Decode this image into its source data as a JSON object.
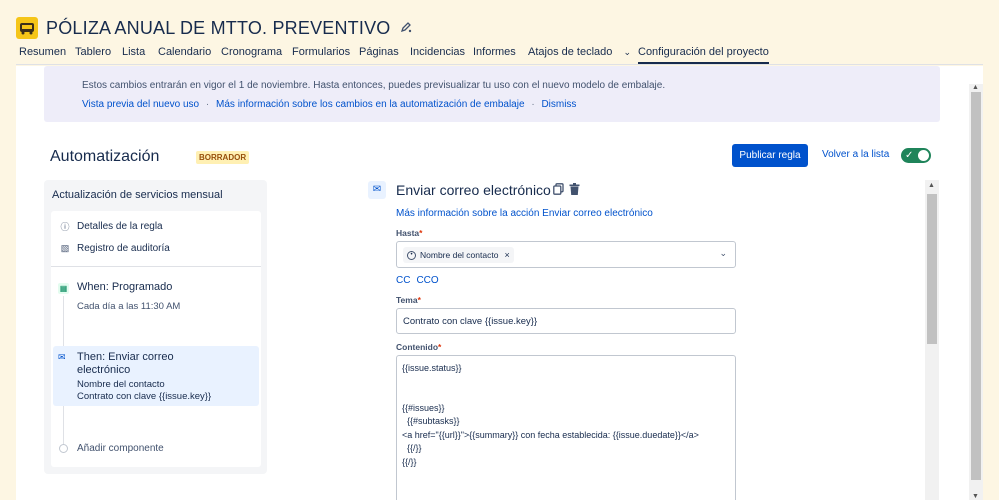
{
  "project": {
    "title": "PÓLIZA ANUAL DE MTTO. PREVENTIVO",
    "icon": "project-avatar-icon",
    "icon_color": "#f5c518"
  },
  "tabs": [
    {
      "label": "Resumen"
    },
    {
      "label": "Tablero"
    },
    {
      "label": "Lista"
    },
    {
      "label": "Calendario"
    },
    {
      "label": "Cronograma"
    },
    {
      "label": "Formularios"
    },
    {
      "label": "Páginas"
    },
    {
      "label": "Incidencias"
    },
    {
      "label": "Informes"
    },
    {
      "label": "Atajos de teclado"
    },
    {
      "label": "Configuración del proyecto"
    }
  ],
  "banner": {
    "text": "Estos cambios entrarán en vigor el 1 de noviembre. Hasta entonces, puedes previsualizar tu uso con el nuevo modelo de embalaje.",
    "links": [
      "Vista previa del nuevo uso",
      "Más información sobre los cambios en la automatización de embalaje",
      "Dismiss"
    ],
    "separator": "·"
  },
  "automation": {
    "title": "Automatización",
    "badge": "BORRADOR",
    "publish_label": "Publicar regla",
    "back_label": "Volver a la lista",
    "toggle_on": true,
    "toggle_color": "#1f845a"
  },
  "rule": {
    "name": "Actualización de servicios mensual",
    "details_label": "Detalles de la regla",
    "audit_label": "Registro de auditoría",
    "trigger_title": "When: Programado",
    "trigger_sub": "Cada día a las 11:30 AM",
    "action_title": "Then: Enviar correo electrónico",
    "action_sub1": "Nombre del contacto",
    "action_sub2": "Contrato con clave {{issue.key}}",
    "add_label": "Añadir componente"
  },
  "editor": {
    "title": "Enviar correo electrónico",
    "more_link": "Más información sobre la acción Enviar correo electrónico",
    "to_label": "Hasta",
    "to_chip": "Nombre del contacto",
    "cc": "CC",
    "bcc": "CCO",
    "subject_label": "Tema",
    "subject_value": "Contrato con clave {{issue.key}}",
    "content_label": "Contenido",
    "required_mark": "*",
    "content_lines": [
      "{{issue.status}}",
      "",
      "",
      "{{#issues}}",
      "  {{#subtasks}}",
      "<a href=\"{{url}}\">{{summary}} con fecha establecida: {{issue.duedate}}</a>",
      "  {{/}}",
      "{{/}}"
    ]
  }
}
